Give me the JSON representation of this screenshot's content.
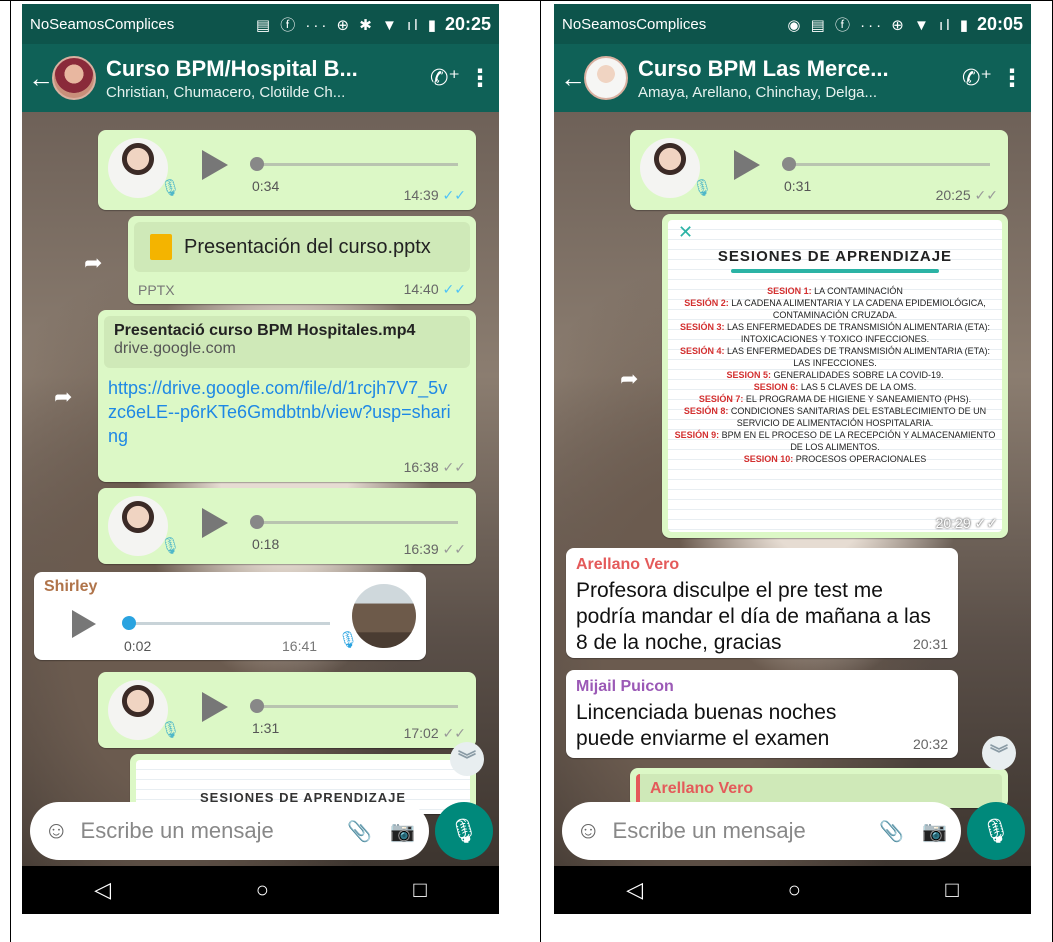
{
  "left": {
    "status": {
      "carrier": "NoSeamosComplices",
      "time": "20:25"
    },
    "header": {
      "title": "Curso BPM/Hospital B...",
      "subtitle": "Christian, Chumacero, Clotilde Ch..."
    },
    "messages": {
      "vm1": {
        "duration": "0:34",
        "time": "14:39"
      },
      "pptx": {
        "filename": "Presentación del curso.pptx",
        "type": "PPTX",
        "time": "14:40"
      },
      "link": {
        "title": "Presentació curso BPM Hospitales.mp4",
        "domain": "drive.google.com",
        "url": "https://drive.google.com/file/d/1rcjh7V7_5vzc6eLE--p6rKTe6Gmdbtnb/view?usp=sharing",
        "time": "16:38"
      },
      "vm2": {
        "duration": "0:18",
        "time": "16:39"
      },
      "shirley": {
        "sender": "Shirley",
        "duration": "0:02",
        "time": "16:41"
      },
      "vm3": {
        "duration": "1:31",
        "time": "17:02"
      },
      "doc_peek": "SESIONES DE APRENDIZAJE"
    },
    "input_placeholder": "Escribe un mensaje"
  },
  "right": {
    "status": {
      "carrier": "NoSeamosComplices",
      "time": "20:05"
    },
    "header": {
      "title": "Curso BPM Las Merce...",
      "subtitle": "Amaya, Arellano, Chinchay, Delga..."
    },
    "messages": {
      "vm1": {
        "duration": "0:31",
        "time": "20:25"
      },
      "doc": {
        "title": "SESIONES DE APRENDIZAJE",
        "time": "20:29",
        "sessions": [
          {
            "label": "SESION 1:",
            "text": "LA CONTAMINACIÓN"
          },
          {
            "label": "SESIÓN 2:",
            "text": "LA CADENA ALIMENTARIA Y LA CADENA EPIDEMIOLÓGICA, CONTAMINACIÓN CRUZADA."
          },
          {
            "label": "SESIÓN 3:",
            "text": "LAS ENFERMEDADES DE TRANSMISIÓN ALIMENTARIA (ETA): INTOXICACIONES Y TOXICO INFECCIONES."
          },
          {
            "label": "SESIÓN 4:",
            "text": "LAS ENFERMEDADES DE TRANSMISIÓN ALIMENTARIA (ETA): LAS INFECCIONES."
          },
          {
            "label": "SESION 5:",
            "text": "GENERALIDADES SOBRE LA COVID-19."
          },
          {
            "label": "SESION 6:",
            "text": "LAS 5 CLAVES DE LA OMS."
          },
          {
            "label": "SESIÓN 7:",
            "text": "EL PROGRAMA DE HIGIENE Y SANEAMIENTO (PHS)."
          },
          {
            "label": "SESIÓN 8:",
            "text": "CONDICIONES SANITARIAS DEL ESTABLECIMIENTO DE UN SERVICIO DE ALIMENTACIÓN HOSPITALARIA."
          },
          {
            "label": "SESIÓN 9:",
            "text": "BPM EN EL PROCESO DE LA RECEPCIÓN Y ALMACENAMIENTO DE LOS ALIMENTOS."
          },
          {
            "label": "SESION 10:",
            "text": "PROCESOS OPERACIONALES"
          }
        ]
      },
      "arellano": {
        "sender": "Arellano Vero",
        "text": "Profesora disculpe el pre test me podría mandar el día de mañana a las 8 de la noche, gracias",
        "time": "20:31"
      },
      "mijail": {
        "sender": "Mijail Puicon",
        "text": "Lincenciada buenas noches puede enviarme el examen",
        "time": "20:32"
      },
      "quote_peek": "Arellano Vero"
    },
    "input_placeholder": "Escribe un mensaje"
  },
  "colors": {
    "header": "#0f6157",
    "status": "#0d544b",
    "outgoing": "#dcf8c6",
    "fab": "#00897b",
    "shirley": "#b0744a",
    "arellano": "#e45a5a",
    "mijail": "#9b59b6"
  }
}
